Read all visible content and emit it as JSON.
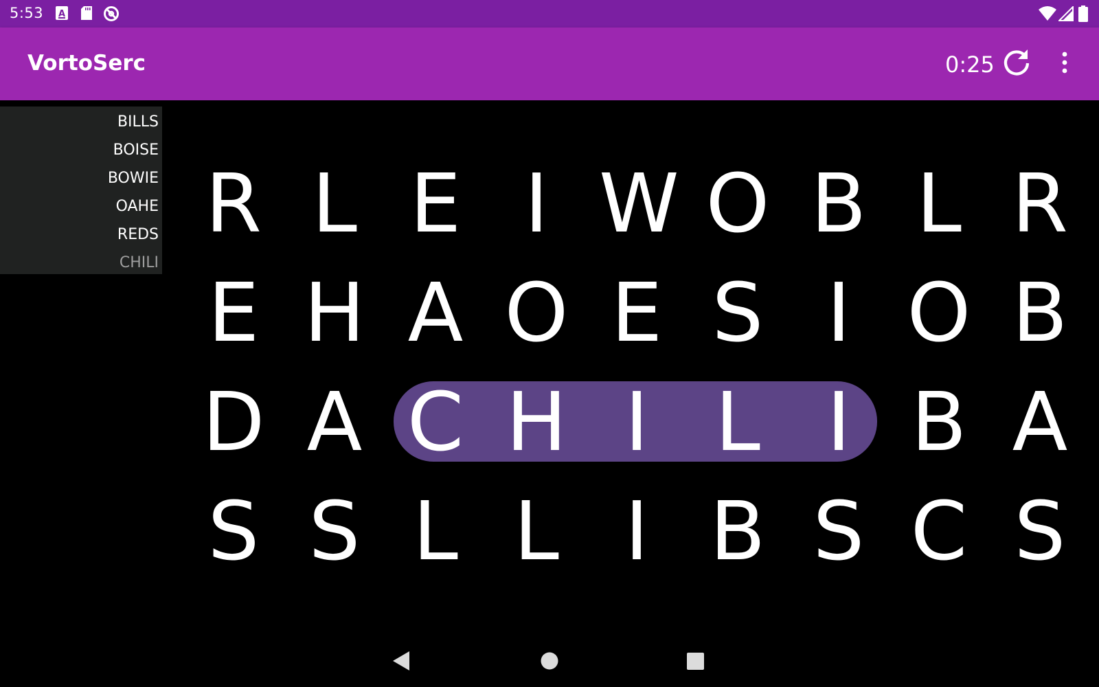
{
  "status_bar": {
    "time": "5:53",
    "icons": [
      "text-notification-icon",
      "sd-card-icon",
      "do-not-disturb-icon",
      "wifi-icon",
      "cell-signal-icon",
      "battery-icon"
    ]
  },
  "app_bar": {
    "title": "VortoSerc",
    "timer": "0:25",
    "actions": [
      "refresh-icon",
      "more-vert-icon"
    ],
    "color": "#9c27b0",
    "status_color": "#7b1fa2"
  },
  "word_list": {
    "words": [
      {
        "text": "BILLS",
        "found": false
      },
      {
        "text": "BOISE",
        "found": false
      },
      {
        "text": "BOWIE",
        "found": false
      },
      {
        "text": "OAHE",
        "found": false
      },
      {
        "text": "REDS",
        "found": false
      },
      {
        "text": "CHILI",
        "found": true
      }
    ],
    "found_color": "#9e9e9e"
  },
  "grid": {
    "rows": [
      [
        "R",
        "L",
        "E",
        "I",
        "W",
        "O",
        "B",
        "L",
        "R"
      ],
      [
        "E",
        "H",
        "A",
        "O",
        "E",
        "S",
        "I",
        "O",
        "B"
      ],
      [
        "D",
        "A",
        "C",
        "H",
        "I",
        "L",
        "I",
        "B",
        "A"
      ],
      [
        "S",
        "S",
        "L",
        "L",
        "I",
        "B",
        "S",
        "C",
        "S"
      ]
    ],
    "found_word": "CHILI",
    "highlight_color": "#5c4486"
  },
  "nav_bar": {
    "buttons": [
      "back-icon",
      "home-icon",
      "recents-icon"
    ]
  }
}
